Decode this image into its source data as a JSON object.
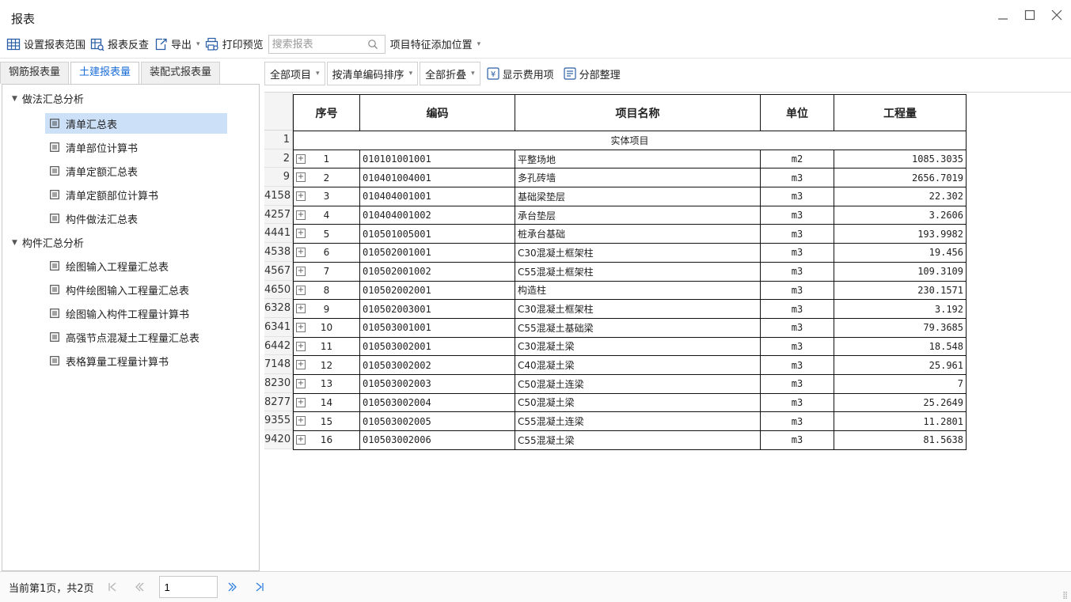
{
  "window": {
    "title": "报表"
  },
  "toolbar": {
    "set_range": "设置报表范围",
    "reverse_check": "报表反查",
    "export": "导出",
    "print_preview": "打印预览",
    "search_placeholder": "搜索报表",
    "feature_position": "项目特征添加位置"
  },
  "tabs": [
    "钢筋报表量",
    "土建报表量",
    "装配式报表量"
  ],
  "tree": {
    "group1": "做法汇总分析",
    "group1_items": [
      "清单汇总表",
      "清单部位计算书",
      "清单定额汇总表",
      "清单定额部位计算书",
      "构件做法汇总表"
    ],
    "group2": "构件汇总分析",
    "group2_items": [
      "绘图输入工程量汇总表",
      "构件绘图输入工程量汇总表",
      "绘图输入构件工程量计算书",
      "高强节点混凝土工程量汇总表",
      "表格算量工程量计算书"
    ]
  },
  "report_toolbar": {
    "all_items": "全部项目",
    "sort": "按清单编码排序",
    "collapse": "全部折叠",
    "show_fees": "显示费用项",
    "arrange": "分部整理"
  },
  "table": {
    "headers": [
      "序号",
      "编码",
      "项目名称",
      "单位",
      "工程量"
    ],
    "section_label": "实体项目",
    "row_numbers": [
      "1",
      "2",
      "9",
      "4158",
      "4257",
      "4441",
      "4538",
      "4567",
      "4650",
      "6328",
      "6341",
      "6442",
      "7148",
      "8230",
      "8277",
      "9355",
      "9420"
    ],
    "rows": [
      {
        "seq": "1",
        "code": "010101001001",
        "name": "平整场地",
        "unit": "m2",
        "qty": "1085.3035"
      },
      {
        "seq": "2",
        "code": "010401004001",
        "name": "多孔砖墙",
        "unit": "m3",
        "qty": "2656.7019"
      },
      {
        "seq": "3",
        "code": "010404001001",
        "name": "基础梁垫层",
        "unit": "m3",
        "qty": "22.302"
      },
      {
        "seq": "4",
        "code": "010404001002",
        "name": "承台垫层",
        "unit": "m3",
        "qty": "3.2606"
      },
      {
        "seq": "5",
        "code": "010501005001",
        "name": "桩承台基础",
        "unit": "m3",
        "qty": "193.9982"
      },
      {
        "seq": "6",
        "code": "010502001001",
        "name": "C30混凝土框架柱",
        "unit": "m3",
        "qty": "19.456"
      },
      {
        "seq": "7",
        "code": "010502001002",
        "name": "C55混凝土框架柱",
        "unit": "m3",
        "qty": "109.3109"
      },
      {
        "seq": "8",
        "code": "010502002001",
        "name": "构造柱",
        "unit": "m3",
        "qty": "230.1571"
      },
      {
        "seq": "9",
        "code": "010502003001",
        "name": "C30混凝土框架柱",
        "unit": "m3",
        "qty": "3.192"
      },
      {
        "seq": "10",
        "code": "010503001001",
        "name": "C55混凝土基础梁",
        "unit": "m3",
        "qty": "79.3685"
      },
      {
        "seq": "11",
        "code": "010503002001",
        "name": "C30混凝土梁",
        "unit": "m3",
        "qty": "18.548"
      },
      {
        "seq": "12",
        "code": "010503002002",
        "name": "C40混凝土梁",
        "unit": "m3",
        "qty": "25.961"
      },
      {
        "seq": "13",
        "code": "010503002003",
        "name": "C50混凝土连梁",
        "unit": "m3",
        "qty": "7"
      },
      {
        "seq": "14",
        "code": "010503002004",
        "name": "C50混凝土梁",
        "unit": "m3",
        "qty": "25.2649"
      },
      {
        "seq": "15",
        "code": "010503002005",
        "name": "C55混凝土连梁",
        "unit": "m3",
        "qty": "11.2801"
      },
      {
        "seq": "16",
        "code": "010503002006",
        "name": "C55混凝土梁",
        "unit": "m3",
        "qty": "81.5638"
      }
    ]
  },
  "pager": {
    "info": "当前第1页，共2页",
    "current_page": "1"
  },
  "colors": {
    "accent": "#1e6fd9",
    "selected_bg": "#cce0f7"
  }
}
